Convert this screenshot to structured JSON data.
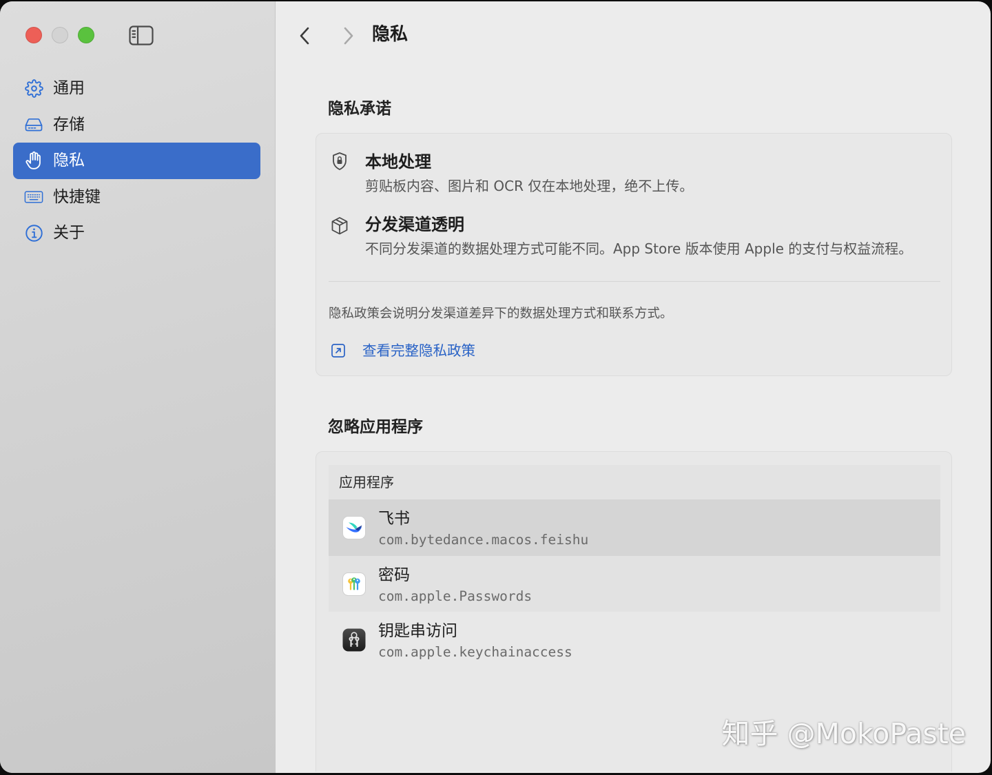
{
  "colors": {
    "accent": "#3a6dc9",
    "sidebar_icon": "#2f6fd6",
    "link": "#2a63c6",
    "traffic_close": "#ed5f57",
    "traffic_minimize": "#d3d3d3",
    "traffic_zoom": "#5ac23e",
    "selected_row": "#d5d5d5"
  },
  "toolbar": {
    "sidebar_toggle_icon": "sidebar-toggle-icon",
    "back_icon": "chevron-left-icon",
    "forward_icon": "chevron-right-icon",
    "back_enabled": true,
    "forward_enabled": false
  },
  "sidebar": {
    "items": [
      {
        "label": "通用",
        "icon": "gear-icon",
        "selected": false
      },
      {
        "label": "存储",
        "icon": "drive-icon",
        "selected": false
      },
      {
        "label": "隐私",
        "icon": "hand-icon",
        "selected": true
      },
      {
        "label": "快捷键",
        "icon": "keyboard-icon",
        "selected": false
      },
      {
        "label": "关于",
        "icon": "info-icon",
        "selected": false
      }
    ]
  },
  "header": {
    "title": "隐私"
  },
  "privacy_commitment": {
    "heading": "隐私承诺",
    "items": [
      {
        "icon": "lock-shield-icon",
        "title": "本地处理",
        "description": "剪贴板内容、图片和 OCR 仅在本地处理，绝不上传。"
      },
      {
        "icon": "box-icon",
        "title": "分发渠道透明",
        "description": "不同分发渠道的数据处理方式可能不同。App Store 版本使用 Apple 的支付与权益流程。"
      }
    ],
    "policy_note": "隐私政策会说明分发渠道差异下的数据处理方式和联系方式。",
    "policy_link": "查看完整隐私政策",
    "policy_link_icon": "external-link-icon"
  },
  "ignored_apps": {
    "heading": "忽略应用程序",
    "column_header": "应用程序",
    "rows": [
      {
        "name": "飞书",
        "bundle_id": "com.bytedance.macos.feishu",
        "icon": "feishu-app-icon",
        "selected": true
      },
      {
        "name": "密码",
        "bundle_id": "com.apple.Passwords",
        "icon": "passwords-app-icon",
        "selected": false
      },
      {
        "name": "钥匙串访问",
        "bundle_id": "com.apple.keychainaccess",
        "icon": "keychain-access-app-icon",
        "selected": false
      }
    ]
  },
  "watermark": "知乎 @MokoPaste"
}
